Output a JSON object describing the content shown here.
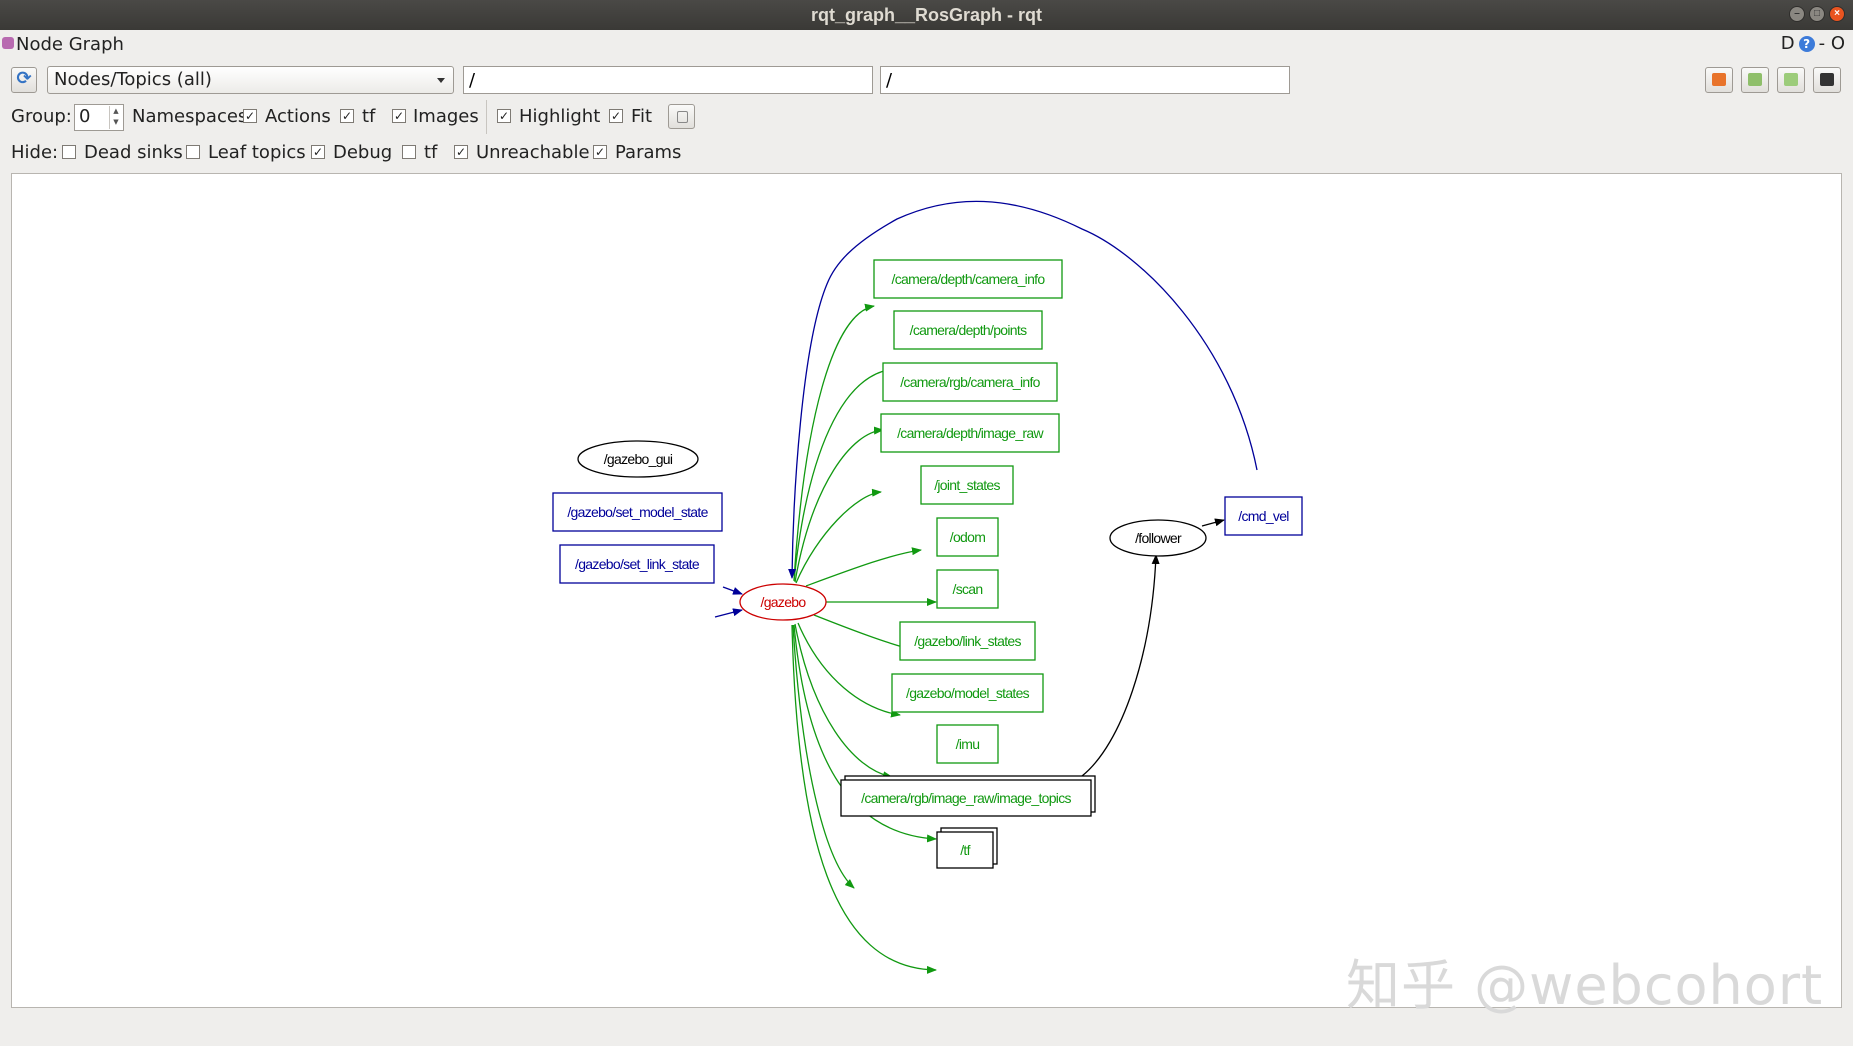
{
  "window": {
    "title": "rqt_graph__RosGraph - rqt"
  },
  "plugin": {
    "title": "Node Graph",
    "right_label": "D",
    "dash_label": "- O"
  },
  "toolbar": {
    "mode_select": "Nodes/Topics (all)",
    "node_filter": "/",
    "topic_filter": "/"
  },
  "group_row": {
    "group_label": "Group:",
    "group_value": "0",
    "namespaces_label": "Namespaces",
    "namespaces_checked": true,
    "actions_label": "Actions",
    "actions_checked": true,
    "tf_label": "tf",
    "tf_checked": true,
    "images_label": "Images",
    "images_checked": true,
    "highlight_label": "Highlight",
    "highlight_checked": true,
    "fit_label": "Fit",
    "fit_checked": true
  },
  "hide_row": {
    "hide_label": "Hide:",
    "dead_sinks_label": "Dead sinks",
    "dead_sinks_checked": false,
    "leaf_topics_label": "Leaf topics",
    "leaf_topics_checked": false,
    "debug_label": "Debug",
    "debug_checked": true,
    "tf_label": "tf",
    "tf_checked": false,
    "unreachable_label": "Unreachable",
    "unreachable_checked": true,
    "params_label": "Params",
    "params_checked": true
  },
  "colors": {
    "publisher_topic": "#119911",
    "subscriber_topic": "#000099",
    "selected_node": "#cc0000",
    "plain": "#000000"
  },
  "graph": {
    "nodes": {
      "gazebo_gui": "/gazebo_gui",
      "gazebo": "/gazebo",
      "follower": "/follower"
    },
    "topics": {
      "set_model_state": "/gazebo/set_model_state",
      "set_link_state": "/gazebo/set_link_state",
      "depth_camera_info": "/camera/depth/camera_info",
      "depth_points": "/camera/depth/points",
      "rgb_camera_info": "/camera/rgb/camera_info",
      "depth_image_raw": "/camera/depth/image_raw",
      "joint_states": "/joint_states",
      "odom": "/odom",
      "scan": "/scan",
      "link_states": "/gazebo/link_states",
      "model_states": "/gazebo/model_states",
      "imu": "/imu",
      "image_topics": "/camera/rgb/image_raw/image_topics",
      "tf": "/tf",
      "cmd_vel": "/cmd_vel"
    }
  },
  "watermark": "知乎 @webcohort"
}
